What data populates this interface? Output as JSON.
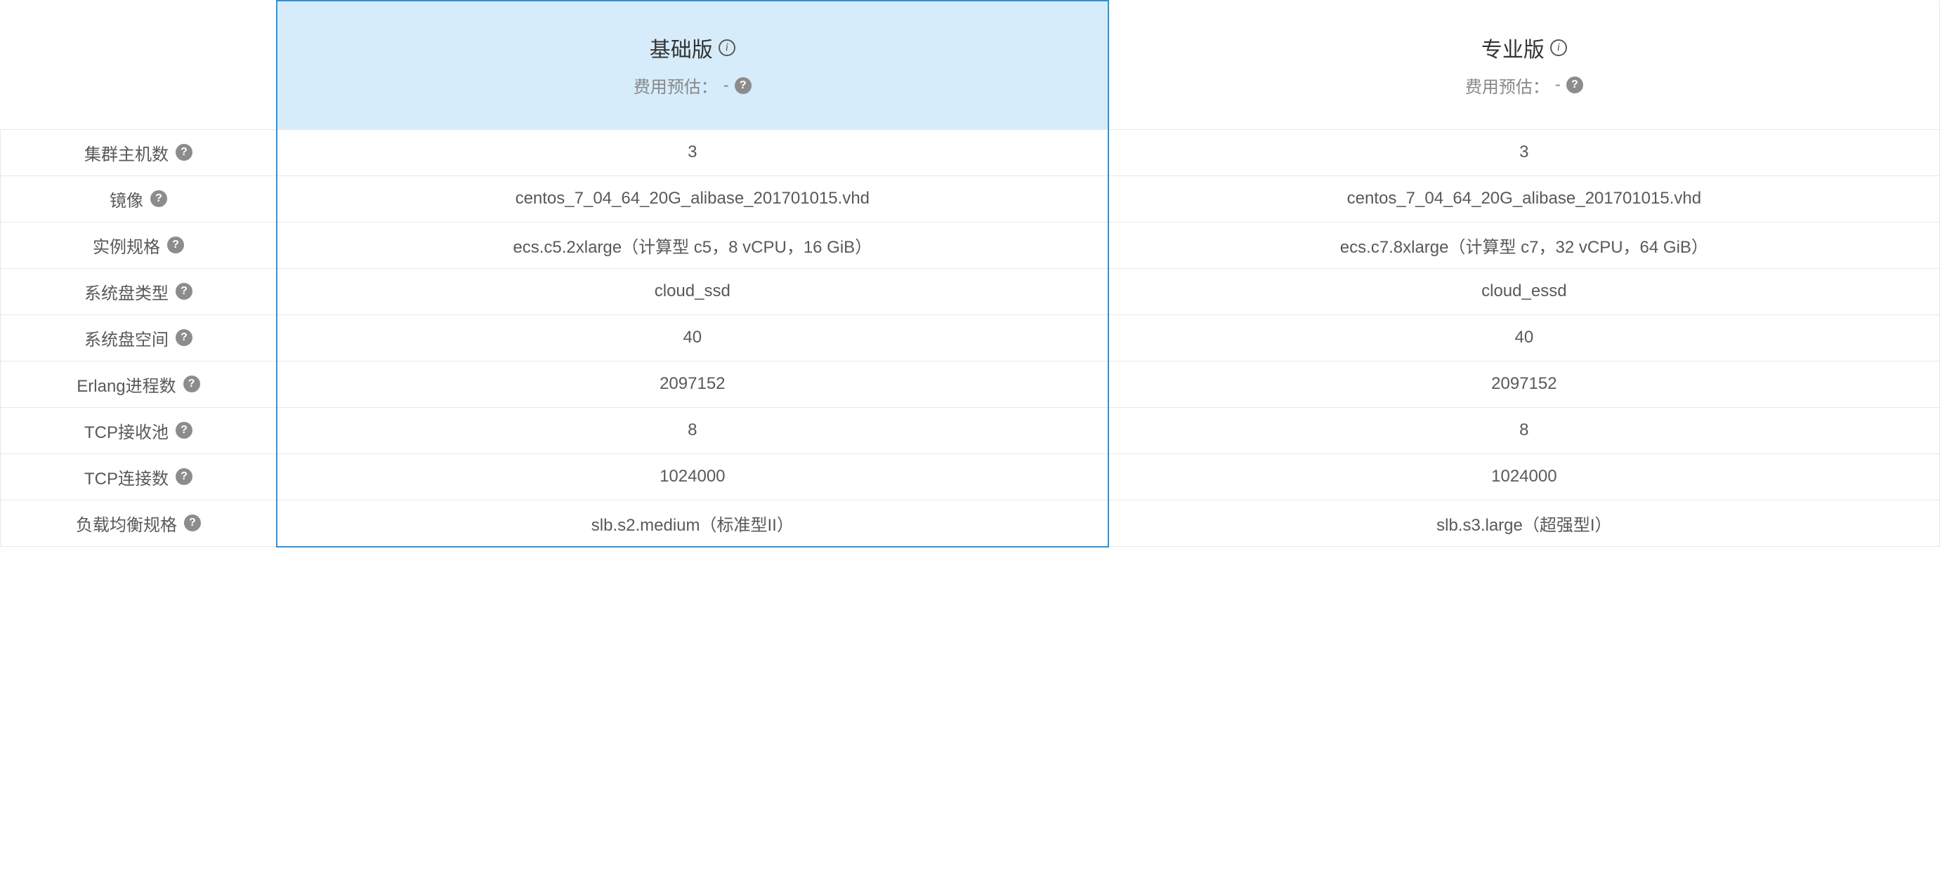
{
  "plans": {
    "basic": {
      "title": "基础版",
      "costLabel": "费用预估：",
      "costValue": "-"
    },
    "pro": {
      "title": "专业版",
      "costLabel": "费用预估：",
      "costValue": "-"
    }
  },
  "rows": [
    {
      "label": "集群主机数",
      "basic": "3",
      "pro": "3"
    },
    {
      "label": "镜像",
      "basic": "centos_7_04_64_20G_alibase_201701015.vhd",
      "pro": "centos_7_04_64_20G_alibase_201701015.vhd"
    },
    {
      "label": "实例规格",
      "basic": "ecs.c5.2xlarge（计算型 c5，8 vCPU，16 GiB）",
      "pro": "ecs.c7.8xlarge（计算型 c7，32 vCPU，64 GiB）"
    },
    {
      "label": "系统盘类型",
      "basic": "cloud_ssd",
      "pro": "cloud_essd"
    },
    {
      "label": "系统盘空间",
      "basic": "40",
      "pro": "40"
    },
    {
      "label": "Erlang进程数",
      "basic": "2097152",
      "pro": "2097152"
    },
    {
      "label": "TCP接收池",
      "basic": "8",
      "pro": "8"
    },
    {
      "label": "TCP连接数",
      "basic": "1024000",
      "pro": "1024000"
    },
    {
      "label": "负载均衡规格",
      "basic": "slb.s2.medium（标准型II）",
      "pro": "slb.s3.large（超强型I）"
    }
  ]
}
